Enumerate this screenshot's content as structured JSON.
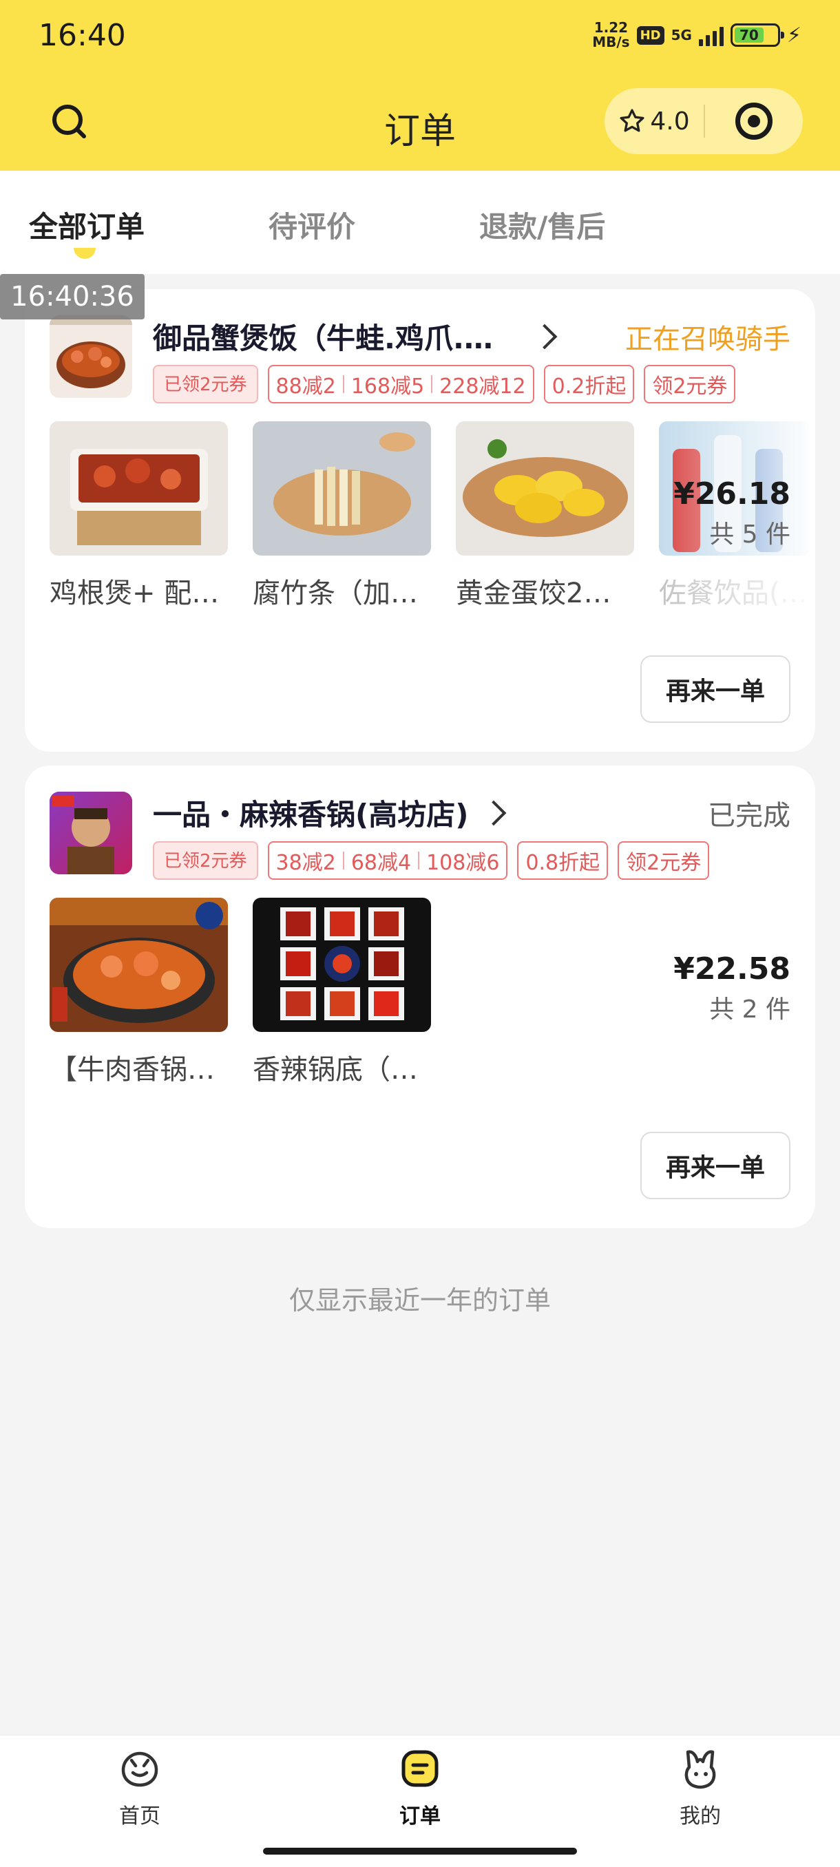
{
  "status_bar": {
    "time": "16:40",
    "net_speed_top": "1.22",
    "net_speed_bottom": "MB/s",
    "hd": "HD",
    "network": "5G",
    "battery": "70"
  },
  "header": {
    "title": "订单",
    "rating": "4.0",
    "colors": {
      "brand_yellow": "#fce24a",
      "capsule": "#fdf0a0"
    }
  },
  "tabs": [
    {
      "label": "全部订单",
      "active": true
    },
    {
      "label": "待评价",
      "active": false
    },
    {
      "label": "退款/售后",
      "active": false
    }
  ],
  "time_overlay": "16:40:36",
  "orders": [
    {
      "shop_name": "御品蟹煲饭（牛蛙.鸡爪.明…",
      "status": "正在召唤骑手",
      "status_color": "#f0a020",
      "coupon": "已领2元券",
      "promos": [
        [
          "88减2",
          "168减5",
          "228减12"
        ],
        [
          "0.2折起"
        ],
        [
          "领2元券"
        ]
      ],
      "items": [
        {
          "name": "鸡根煲+ 配…"
        },
        {
          "name": "腐竹条（加…"
        },
        {
          "name": "黄金蛋饺2…"
        },
        {
          "name": "佐餐饮品(…"
        }
      ],
      "price": "¥26.18",
      "count": "共 5 件",
      "reorder": "再来一单"
    },
    {
      "shop_name": "一品・麻辣香锅(高坊店)",
      "status": "已完成",
      "status_color": "#666666",
      "coupon": "已领2元券",
      "promos": [
        [
          "38减2",
          "68减4",
          "108减6"
        ],
        [
          "0.8折起"
        ],
        [
          "领2元券"
        ]
      ],
      "items": [
        {
          "name": "【牛肉香锅…"
        },
        {
          "name": "香辣锅底（…"
        }
      ],
      "price": "¥22.58",
      "count": "共 2 件",
      "reorder": "再来一单"
    }
  ],
  "footer_note": "仅显示最近一年的订单",
  "bottom_nav": [
    {
      "label": "首页",
      "icon": "home-face-icon"
    },
    {
      "label": "订单",
      "icon": "order-list-icon",
      "active": true
    },
    {
      "label": "我的",
      "icon": "bunny-profile-icon"
    }
  ]
}
